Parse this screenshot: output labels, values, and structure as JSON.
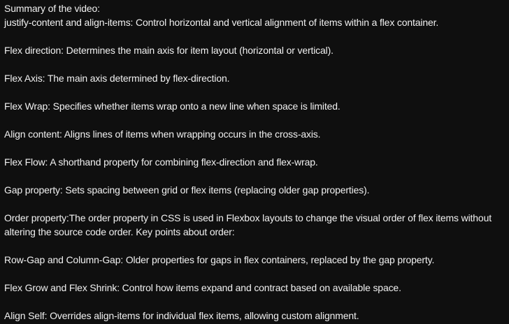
{
  "description": {
    "heading": "Summary of the video:",
    "items": [
      "justify-content and align-items: Control horizontal and vertical alignment of items within a flex container.",
      "Flex direction: Determines the main axis for item layout (horizontal or vertical).",
      "Flex Axis: The main axis determined by flex-direction.",
      "Flex Wrap: Specifies whether items wrap onto a new line when space is limited.",
      "Align content: Aligns lines of items when wrapping occurs in the cross-axis.",
      "Flex Flow: A shorthand property for combining flex-direction and flex-wrap.",
      "Gap property: Sets spacing between grid or flex items (replacing older gap properties).",
      "Order property:The order property in CSS is used in Flexbox layouts to change the visual order of flex items without altering the source code order. Key points about order:",
      "Row-Gap and Column-Gap: Older properties for gaps in flex containers, replaced by the gap property.",
      "Flex Grow and Flex Shrink: Control how items expand and contract based on available space.",
      "Align Self: Overrides align-items for individual flex items, allowing custom alignment."
    ]
  },
  "colors": {
    "background": "#0f0f0f",
    "text": "#f1f1f1"
  }
}
